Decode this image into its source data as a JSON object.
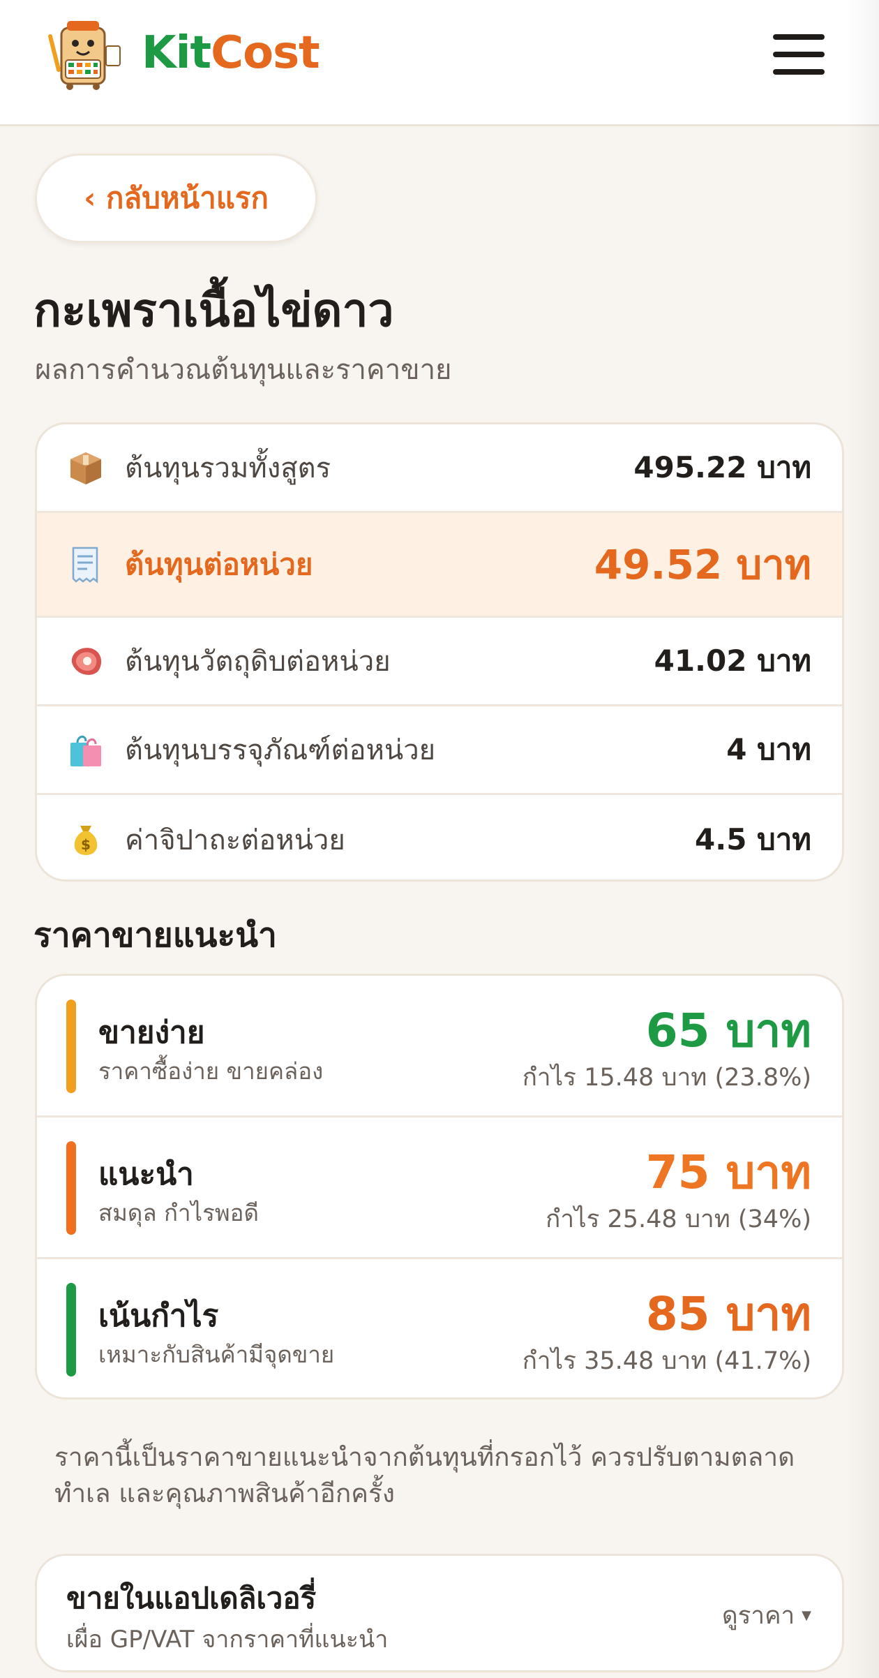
{
  "brand": {
    "part1": "Kit",
    "part2": "Cost"
  },
  "nav": {
    "back_label": "‹ กลับหน้าแรก"
  },
  "page": {
    "title": "กะเพราเนื้อไข่ดาว",
    "subtitle": "ผลการคำนวณต้นทุนและราคาขาย"
  },
  "costs": [
    {
      "icon": "package-icon",
      "label": "ต้นทุนรวมทั้งสูตร",
      "value": "495.22 บาท"
    },
    {
      "icon": "receipt-icon",
      "label": "ต้นทุนต่อหน่วย",
      "value": "49.52 บาท"
    },
    {
      "icon": "meat-icon",
      "label": "ต้นทุนวัตถุดิบต่อหน่วย",
      "value": "41.02 บาท"
    },
    {
      "icon": "shopping-bag-icon",
      "label": "ต้นทุนบรรจุภัณฑ์ต่อหน่วย",
      "value": "4 บาท"
    },
    {
      "icon": "money-bag-icon",
      "label": "ค่าจิปาถะต่อหน่วย",
      "value": "4.5 บาท"
    }
  ],
  "pricing": {
    "section_title": "ราคาขายแนะนำ",
    "tiers": [
      {
        "name": "ขายง่าย",
        "desc": "ราคาซื้อง่าย ขายคล่อง",
        "price": "65 บาท",
        "profit": "กำไร 15.48 บาท (23.8%)",
        "bar_color": "#f0a01e",
        "price_color": "#1f9a44"
      },
      {
        "name": "แนะนำ",
        "desc": "สมดุล กำไรพอดี",
        "price": "75 บาท",
        "profit": "กำไร 25.48 บาท (34%)",
        "bar_color": "#f07020",
        "price_color": "#ee7522"
      },
      {
        "name": "เน้นกำไร",
        "desc": "เหมาะกับสินค้ามีจุดขาย",
        "price": "85 บาท",
        "profit": "กำไร 35.48 บาท (41.7%)",
        "bar_color": "#1f9a44",
        "price_color": "#e4681e"
      }
    ]
  },
  "note": "ราคานี้เป็นราคาขายแนะนำจากต้นทุนที่กรอกไว้ ควรปรับตามตลาด ทำเล และคุณภาพสินค้าอีกครั้ง",
  "delivery": {
    "title": "ขายในแอปเดลิเวอรี่",
    "subtitle": "เผื่อ GP/VAT จากราคาที่แนะนำ",
    "link_label": "ดูราคา"
  },
  "colors": {
    "brand_green": "#1f9a44",
    "brand_orange": "#e4681e",
    "background": "#f8f4ef"
  }
}
